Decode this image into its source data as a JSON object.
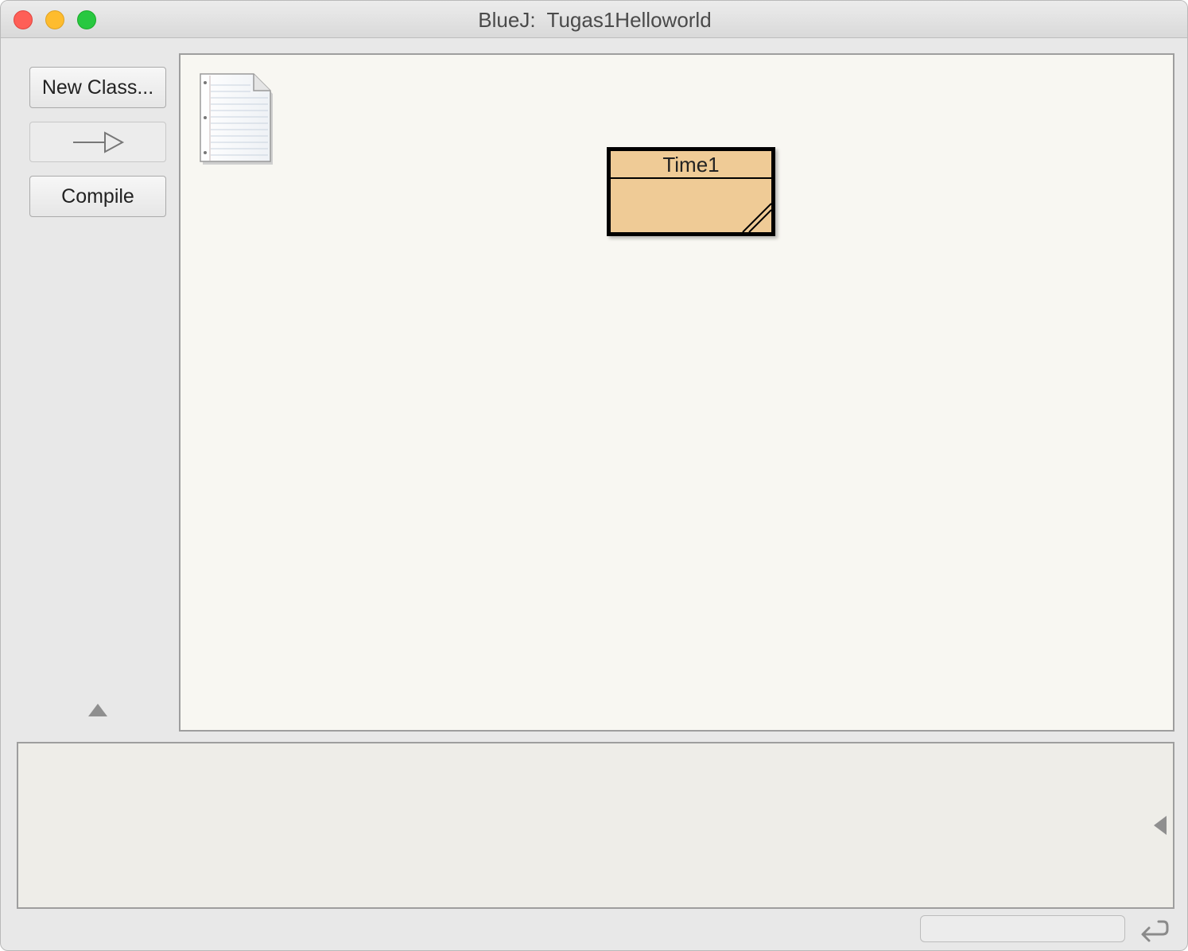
{
  "window": {
    "title": "BlueJ:  Tugas1Helloworld"
  },
  "toolbar": {
    "new_class_label": "New Class...",
    "inheritance_arrow_icon": "inheritance-arrow-icon",
    "compile_label": "Compile"
  },
  "diagram": {
    "readme_icon": "document-icon",
    "classes": [
      {
        "name": "Time1",
        "color": "#efcb96"
      }
    ]
  },
  "colors": {
    "canvas_background": "#f8f7f2",
    "terminal_background": "#eeede8",
    "class_fill": "#efcb96",
    "close": "#fe5f57",
    "minimize": "#febc2e",
    "maximize": "#28c840"
  }
}
